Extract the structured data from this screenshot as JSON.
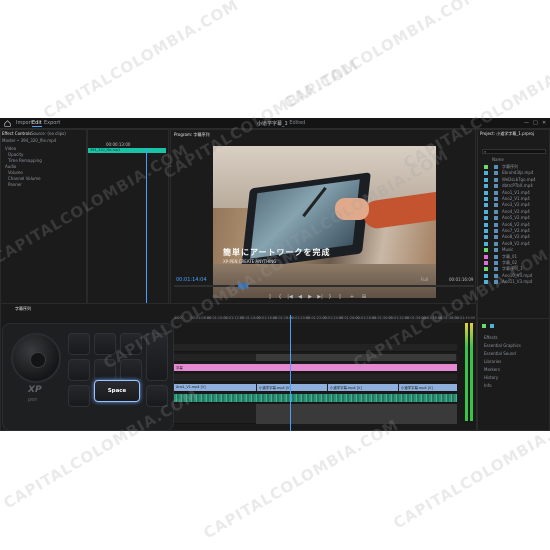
{
  "app": {
    "title": "小道学字幕_1",
    "title_suffix": "- Edited",
    "nav": [
      "Import",
      "Edit",
      "Export"
    ],
    "window_controls": [
      "—",
      "□",
      "✕"
    ]
  },
  "source_panel": {
    "tabs": [
      "Effect Controls",
      "Source: (no clips)"
    ],
    "clip_name": "Master • 394_320_file.mp4",
    "items": [
      "Video",
      "Opacity",
      "Time Remapping",
      "Audio",
      "Volume",
      "Channel Volume",
      "Panner"
    ],
    "mini_timecode": "00:00:13:00",
    "mini_clip": "394_320_file.mp4"
  },
  "program": {
    "tab": "Program: 字幕序列",
    "subtitle_jp": "簡単にアートワークを完成",
    "subtitle_small": "XP-PEN CREATE ANYTHING",
    "timecode_left": "00:01:14:04",
    "timecode_right": "00:01:16:09",
    "fit": "Full",
    "controls": [
      "⟦",
      "{",
      "|◀",
      "◀",
      "▶",
      "▶|",
      "}",
      "⟧",
      "+",
      "⊞"
    ]
  },
  "project": {
    "tab": "Project: 小道学字幕_1.prproj",
    "search_icon": "search-icon",
    "header": "Name",
    "items": [
      {
        "name": "字幕序列",
        "color": "#6bd96b"
      },
      {
        "name": "Ebruhd3Ijs.mp4",
        "color": "#4fb3d9"
      },
      {
        "name": "WeDsLbTgo.mp4",
        "color": "#4fb3d9"
      },
      {
        "name": "dbtrcPTbX.mp4",
        "color": "#4fb3d9"
      },
      {
        "name": "Ano1_V1.mp4",
        "color": "#4fb3d9"
      },
      {
        "name": "Ano2_V1.mp4",
        "color": "#4fb3d9"
      },
      {
        "name": "Ano3_V2.mp4",
        "color": "#4fb3d9"
      },
      {
        "name": "Ano4_V2.mp4",
        "color": "#4fb3d9"
      },
      {
        "name": "Ano5_V2.mp4",
        "color": "#4fb3d9"
      },
      {
        "name": "Ano6_V2.mp4",
        "color": "#4fb3d9"
      },
      {
        "name": "Ano7_V2.mp4",
        "color": "#4fb3d9"
      },
      {
        "name": "Ano8_V2.mp4",
        "color": "#4fb3d9"
      },
      {
        "name": "Ano9_V2.mp4",
        "color": "#4fb3d9"
      },
      {
        "name": "Music",
        "color": "#6bd96b"
      },
      {
        "name": "字幕_01",
        "color": "#e36bd9"
      },
      {
        "name": "字幕_02",
        "color": "#e36bd9"
      },
      {
        "name": "字幕序列_1",
        "color": "#6bd96b"
      },
      {
        "name": "Ano10_V3.mp4",
        "color": "#4fb3d9"
      },
      {
        "name": "Ano11_V3.mp4",
        "color": "#4fb3d9"
      }
    ],
    "effects": [
      "Effects",
      "Essential Graphics",
      "Essential Sound",
      "Libraries",
      "Markers",
      "History",
      "Info"
    ]
  },
  "timeline": {
    "tab": "字幕序列",
    "ruler": [
      "1:00",
      "00:01:08:00",
      "00:01:10:00",
      "00:01:12:00",
      "00:01:14:00",
      "00:01:16:00",
      "00:01:18:00",
      "00:01:20:00",
      "00:01:22:00",
      "00:01:24:00",
      "00:01:26:00",
      "00:01:28:00",
      "00:01:30:00",
      "00:01:32:00",
      "00:01:34:00",
      "00:01:36:00",
      "00:01:38:00",
      "00:01:40:00"
    ],
    "clips": {
      "pink": "字幕",
      "blue_1": "Ano1_V1.mp4 [V]",
      "blue_2": "小道学字幕.mp4 [V]",
      "blue_3": "小道学字幕.mp4 [V]",
      "blue_4": "小道学字幕.mp4 [V]"
    },
    "colors": {
      "pink": "#e58ad2",
      "blue": "#8fb0dc",
      "green": "#2f8f74",
      "accent": "#4a9eff",
      "tealtab": "#19c3a6"
    }
  },
  "keypad": {
    "space_label": "Space",
    "logo": "XP",
    "logo_sub": "pen"
  },
  "watermark": "CAPITALCOLOMBIA.COM"
}
